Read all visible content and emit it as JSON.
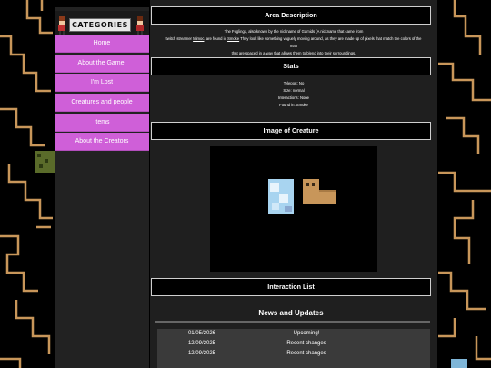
{
  "sidebar": {
    "header_label": "CATEGORIES",
    "items": [
      {
        "label": "Home"
      },
      {
        "label": "About the Game!"
      },
      {
        "label": "I'm Lost"
      },
      {
        "label": "Creatures and people"
      },
      {
        "label": "Items"
      },
      {
        "label": "About the Creators"
      }
    ]
  },
  "area_description": {
    "title": "Area Description",
    "line1": "The Foglings, also known by the nickname of Gamids (A nickname that came from",
    "line2_pre": "twitch streamer ",
    "link1": "Mimoc",
    "line2_mid": ", are found in ",
    "link2": "Smoke",
    "line2_post": " They look like something vaguely moving around, as they are made up of pixels that match the colors of the",
    "line3": "map",
    "line4": "that are spaced in a way that allows them to blend into their surroundings."
  },
  "stats": {
    "title": "Stats",
    "lines": [
      "Teleport: No",
      "Size: normal",
      "Interactions: None",
      "Found in: Smoke"
    ]
  },
  "image_section": {
    "title": "Image of Creature"
  },
  "interaction_section": {
    "title": "Interaction List"
  },
  "news": {
    "title": "News and Updates",
    "rows": [
      {
        "date": "01/05/2026",
        "desc": "Upcoming!"
      },
      {
        "date": "12/09/2025",
        "desc": "Recent changes"
      },
      {
        "date": "12/09/2025",
        "desc": "Recent changes"
      }
    ]
  },
  "colors": {
    "nav_bg": "#cf5fd8",
    "maze": "#c8965a",
    "panel": "#1f1f1f"
  }
}
